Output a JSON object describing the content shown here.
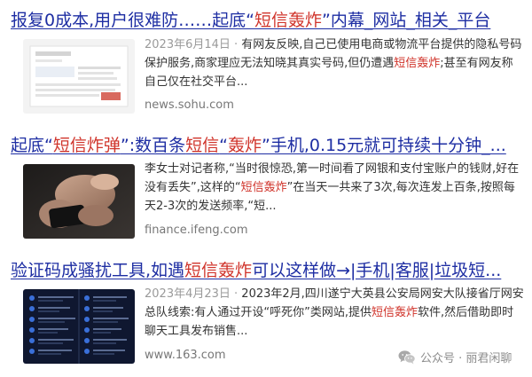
{
  "results": [
    {
      "title_parts": [
        {
          "text": "报复0成本,用户很难防……起底“",
          "hl": false
        },
        {
          "text": "短信轰炸",
          "hl": true
        },
        {
          "text": "”内幕_网站_相关_平台",
          "hl": false
        }
      ],
      "date": "2023年6月14日 · ",
      "snippet_parts": [
        {
          "text": "有网友反映,自己已使用电商或物流平台提供的隐私号码保护服务,商家理应无法知晓其真实号码,但仍遭遇",
          "hl": false
        },
        {
          "text": "短信轰炸",
          "hl": true
        },
        {
          "text": ";甚至有网友称自己仅在社交平台...",
          "hl": false
        }
      ],
      "source": "news.sohu.com"
    },
    {
      "title_parts": [
        {
          "text": "起底“",
          "hl": false
        },
        {
          "text": "短信炸弹",
          "hl": true
        },
        {
          "text": "”:数百条",
          "hl": false
        },
        {
          "text": "短信",
          "hl": true
        },
        {
          "text": "“",
          "hl": false
        },
        {
          "text": "轰炸",
          "hl": true
        },
        {
          "text": "”手机,0.15元就可持续十分钟_...",
          "hl": false
        }
      ],
      "date": "",
      "snippet_parts": [
        {
          "text": "李女士对记者称,“当时很惊恐,第一时间看了网银和支付宝账户的钱财,好在没有丢失”,这样的“",
          "hl": false
        },
        {
          "text": "短信轰炸",
          "hl": true
        },
        {
          "text": "”在当天一共来了3次,每次连发上百条,按照每天2-3次的发送频率,“短...",
          "hl": false
        }
      ],
      "source": "finance.ifeng.com"
    },
    {
      "title_parts": [
        {
          "text": "验证码成骚扰工具,如遇",
          "hl": false
        },
        {
          "text": "短信轰炸",
          "hl": true
        },
        {
          "text": "可以这样做→|手机|客服|垃圾短...",
          "hl": false
        }
      ],
      "date": "2023年4月23日 · ",
      "snippet_parts": [
        {
          "text": "2023年2月,四川遂宁大英县公安局网安大队接省厅网安总队线索:有人通过开设“呼死你”类网站,提供",
          "hl": false
        },
        {
          "text": "短信轰炸",
          "hl": true
        },
        {
          "text": "软件,然后借助即时聊天工具发布销售...",
          "hl": false
        }
      ],
      "source": "www.163.com"
    }
  ],
  "watermark": {
    "icon": "wechat-icon",
    "text": "公众号 · 丽君闲聊"
  },
  "colors": {
    "title": "#1e2ea3",
    "highlight": "#d0342b",
    "date": "#9a9a9a",
    "snippet": "#333333",
    "source": "#777777"
  }
}
